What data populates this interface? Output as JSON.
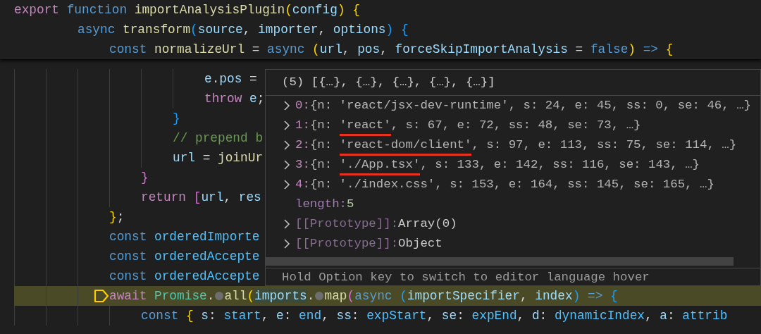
{
  "editor": {
    "lines": [
      {
        "pinned": true,
        "current": false,
        "breakpoint": false,
        "tokens": [
          {
            "kind": "k",
            "text": "export"
          },
          {
            "kind": "s",
            "text": " function"
          },
          {
            "kind": "f",
            "text": " importAnalysisPlugin"
          },
          {
            "kind": "b1",
            "text": "("
          },
          {
            "kind": "v",
            "text": "config"
          },
          {
            "kind": "b1",
            "text": ")"
          },
          {
            "kind": "b1",
            "text": " {"
          }
        ],
        "children": [
          {
            "children": [
              {
                "pinned": true,
                "current": false,
                "breakpoint": false,
                "tokens": [
                  {
                    "kind": "s",
                    "text": "async"
                  },
                  {
                    "kind": "f",
                    "text": " transform"
                  },
                  {
                    "kind": "b3",
                    "text": "("
                  },
                  {
                    "kind": "v",
                    "text": "source"
                  },
                  {
                    "kind": "p",
                    "text": ","
                  },
                  {
                    "kind": "v",
                    "text": " importer"
                  },
                  {
                    "kind": "p",
                    "text": ","
                  },
                  {
                    "kind": "v",
                    "text": " options"
                  },
                  {
                    "kind": "b3",
                    "text": ")"
                  },
                  {
                    "kind": "b3",
                    "text": " {"
                  }
                ],
                "children": [
                  {
                    "pinned": true,
                    "current": false,
                    "breakpoint": false,
                    "tokens": [
                      {
                        "kind": "s",
                        "text": "const"
                      },
                      {
                        "kind": "f",
                        "text": " normalizeUrl"
                      },
                      {
                        "kind": "p",
                        "text": " ="
                      },
                      {
                        "kind": "s",
                        "text": " async"
                      },
                      {
                        "kind": "b1",
                        "text": " ("
                      },
                      {
                        "kind": "v",
                        "text": "url"
                      },
                      {
                        "kind": "p",
                        "text": ","
                      },
                      {
                        "kind": "v",
                        "text": " pos"
                      },
                      {
                        "kind": "p",
                        "text": ","
                      },
                      {
                        "kind": "v",
                        "text": " forceSkipImportAnalysis"
                      },
                      {
                        "kind": "p",
                        "text": " ="
                      },
                      {
                        "kind": "s",
                        "text": " false"
                      },
                      {
                        "kind": "b1",
                        "text": ")"
                      },
                      {
                        "kind": "s",
                        "text": " =>"
                      },
                      {
                        "kind": "b1",
                        "text": " {"
                      }
                    ],
                    "children": [
                      {
                        "children": [
                          {
                            "children": [
                              {
                                "pinned": false,
                                "current": false,
                                "breakpoint": false,
                                "tokens": [
                                  {
                                    "kind": "v",
                                    "text": "e"
                                  },
                                  {
                                    "kind": "p",
                                    "text": "."
                                  },
                                  {
                                    "kind": "v",
                                    "text": "pos"
                                  },
                                  {
                                    "kind": "p",
                                    "text": " ="
                                  }
                                ]
                              },
                              {
                                "pinned": false,
                                "current": false,
                                "breakpoint": false,
                                "tokens": [
                                  {
                                    "kind": "k",
                                    "text": "throw"
                                  },
                                  {
                                    "kind": "v",
                                    "text": " e"
                                  },
                                  {
                                    "kind": "p",
                                    "text": ";"
                                  }
                                ]
                              }
                            ]
                          },
                          {
                            "pinned": false,
                            "current": false,
                            "breakpoint": false,
                            "tokens": [
                              {
                                "kind": "b3",
                                "text": "}"
                              }
                            ]
                          },
                          {
                            "pinned": false,
                            "current": false,
                            "breakpoint": false,
                            "tokens": [
                              {
                                "kind": "cm",
                                "text": "// prepend b"
                              }
                            ]
                          },
                          {
                            "pinned": false,
                            "current": false,
                            "breakpoint": false,
                            "tokens": [
                              {
                                "kind": "v",
                                "text": "url"
                              },
                              {
                                "kind": "p",
                                "text": " ="
                              },
                              {
                                "kind": "f",
                                "text": " joinUr"
                              }
                            ]
                          }
                        ]
                      },
                      {
                        "pinned": false,
                        "current": false,
                        "breakpoint": false,
                        "tokens": [
                          {
                            "kind": "b2",
                            "text": "}"
                          }
                        ]
                      },
                      {
                        "pinned": false,
                        "current": false,
                        "breakpoint": false,
                        "tokens": [
                          {
                            "kind": "k",
                            "text": "return"
                          },
                          {
                            "kind": "b2",
                            "text": " ["
                          },
                          {
                            "kind": "v",
                            "text": "url"
                          },
                          {
                            "kind": "p",
                            "text": ","
                          },
                          {
                            "kind": "v",
                            "text": " res"
                          }
                        ]
                      }
                    ]
                  },
                  {
                    "pinned": false,
                    "current": false,
                    "breakpoint": false,
                    "tokens": [
                      {
                        "kind": "b1",
                        "text": "}"
                      },
                      {
                        "kind": "p",
                        "text": ";"
                      }
                    ]
                  },
                  {
                    "pinned": false,
                    "current": false,
                    "breakpoint": false,
                    "tokens": [
                      {
                        "kind": "s",
                        "text": "const"
                      },
                      {
                        "kind": "c",
                        "text": " orderedImporte"
                      }
                    ]
                  },
                  {
                    "pinned": false,
                    "current": false,
                    "breakpoint": false,
                    "tokens": [
                      {
                        "kind": "s",
                        "text": "const"
                      },
                      {
                        "kind": "c",
                        "text": " orderedAccepte"
                      }
                    ]
                  },
                  {
                    "pinned": false,
                    "current": false,
                    "breakpoint": false,
                    "tokens": [
                      {
                        "kind": "s",
                        "text": "const"
                      },
                      {
                        "kind": "c",
                        "text": " orderedAccepte"
                      }
                    ]
                  },
                  {
                    "pinned": false,
                    "current": true,
                    "breakpoint": true,
                    "tokens": [
                      {
                        "kind": "k",
                        "text": "await"
                      },
                      {
                        "kind": "t",
                        "text": " Promise"
                      },
                      {
                        "kind": "p",
                        "text": "."
                      },
                      {
                        "kind": "dot"
                      },
                      {
                        "kind": "f",
                        "text": "all"
                      },
                      {
                        "kind": "b1",
                        "text": "("
                      },
                      {
                        "kind": "hv",
                        "text": "imports"
                      },
                      {
                        "kind": "p",
                        "text": "."
                      },
                      {
                        "kind": "dot"
                      },
                      {
                        "kind": "f",
                        "text": "map"
                      },
                      {
                        "kind": "b2",
                        "text": "("
                      },
                      {
                        "kind": "s",
                        "text": "async"
                      },
                      {
                        "kind": "b3",
                        "text": " ("
                      },
                      {
                        "kind": "v",
                        "text": "importSpecifier"
                      },
                      {
                        "kind": "p",
                        "text": ","
                      },
                      {
                        "kind": "v",
                        "text": " index"
                      },
                      {
                        "kind": "b3",
                        "text": ")"
                      },
                      {
                        "kind": "s",
                        "text": " =>"
                      },
                      {
                        "kind": "b3",
                        "text": " {"
                      }
                    ],
                    "children": [
                      {
                        "pinned": false,
                        "current": false,
                        "breakpoint": false,
                        "tokens": [
                          {
                            "kind": "s",
                            "text": "const"
                          },
                          {
                            "kind": "b1",
                            "text": " {"
                          },
                          {
                            "kind": "v",
                            "text": " s"
                          },
                          {
                            "kind": "p",
                            "text": ":"
                          },
                          {
                            "kind": "c",
                            "text": " start"
                          },
                          {
                            "kind": "p",
                            "text": ","
                          },
                          {
                            "kind": "v",
                            "text": " e"
                          },
                          {
                            "kind": "p",
                            "text": ":"
                          },
                          {
                            "kind": "c",
                            "text": " end"
                          },
                          {
                            "kind": "p",
                            "text": ","
                          },
                          {
                            "kind": "v",
                            "text": " ss"
                          },
                          {
                            "kind": "p",
                            "text": ":"
                          },
                          {
                            "kind": "c",
                            "text": " expStart"
                          },
                          {
                            "kind": "p",
                            "text": ","
                          },
                          {
                            "kind": "v",
                            "text": " se"
                          },
                          {
                            "kind": "p",
                            "text": ":"
                          },
                          {
                            "kind": "c",
                            "text": " expEnd"
                          },
                          {
                            "kind": "p",
                            "text": ","
                          },
                          {
                            "kind": "v",
                            "text": " d"
                          },
                          {
                            "kind": "p",
                            "text": ":"
                          },
                          {
                            "kind": "c",
                            "text": " dynamicIndex"
                          },
                          {
                            "kind": "p",
                            "text": ","
                          },
                          {
                            "kind": "v",
                            "text": " a"
                          },
                          {
                            "kind": "p",
                            "text": ":"
                          },
                          {
                            "kind": "c",
                            "text": " attrib"
                          }
                        ]
                      }
                    ]
                  }
                ]
              }
            ]
          }
        ]
      }
    ]
  },
  "hover": {
    "header": "(5) [{…}, {…}, {…}, {…}, {…}]",
    "entries": [
      {
        "expandable": true,
        "kind": "index",
        "key": "0:",
        "value": [
          {
            "text": "{n: 'react/jsx-dev-runtime', s: 24, e: 45, ss: 0, se: 46, …}",
            "underlined": false
          }
        ]
      },
      {
        "expandable": true,
        "kind": "index",
        "key": "1:",
        "value": [
          {
            "text": "{n: ",
            "underlined": false
          },
          {
            "text": "'react'",
            "underlined": true
          },
          {
            "text": ", s: 67, e: 72, ss: 48, se: 73, …}",
            "underlined": false
          }
        ]
      },
      {
        "expandable": true,
        "kind": "index",
        "key": "2:",
        "value": [
          {
            "text": "{n: ",
            "underlined": false
          },
          {
            "text": "'react-dom/client'",
            "underlined": true
          },
          {
            "text": ", s: 97, e: 113, ss: 75, se: 114, …}",
            "underlined": false
          }
        ]
      },
      {
        "expandable": true,
        "kind": "index",
        "key": "3:",
        "value": [
          {
            "text": "{n: ",
            "underlined": false
          },
          {
            "text": "'./App.tsx'",
            "underlined": true
          },
          {
            "text": ", s: 133, e: 142, ss: 116, se: 143, …}",
            "underlined": false
          }
        ]
      },
      {
        "expandable": true,
        "kind": "index",
        "key": "4:",
        "value": [
          {
            "text": "{n: './index.css', s: 153, e: 164, ss: 145, se: 165, …}",
            "underlined": false
          }
        ]
      },
      {
        "expandable": false,
        "kind": "number",
        "key": "length:",
        "value": [
          {
            "text": "5",
            "underlined": false
          }
        ]
      },
      {
        "expandable": true,
        "kind": "internal",
        "key": "[[Prototype]]:",
        "value": [
          {
            "text": "Array(0)",
            "underlined": false
          }
        ]
      },
      {
        "expandable": true,
        "kind": "internal",
        "key": "[[Prototype]]:",
        "value": [
          {
            "text": "Object",
            "underlined": false
          }
        ]
      }
    ],
    "hint": "Hold Option key to switch to editor language hover"
  }
}
